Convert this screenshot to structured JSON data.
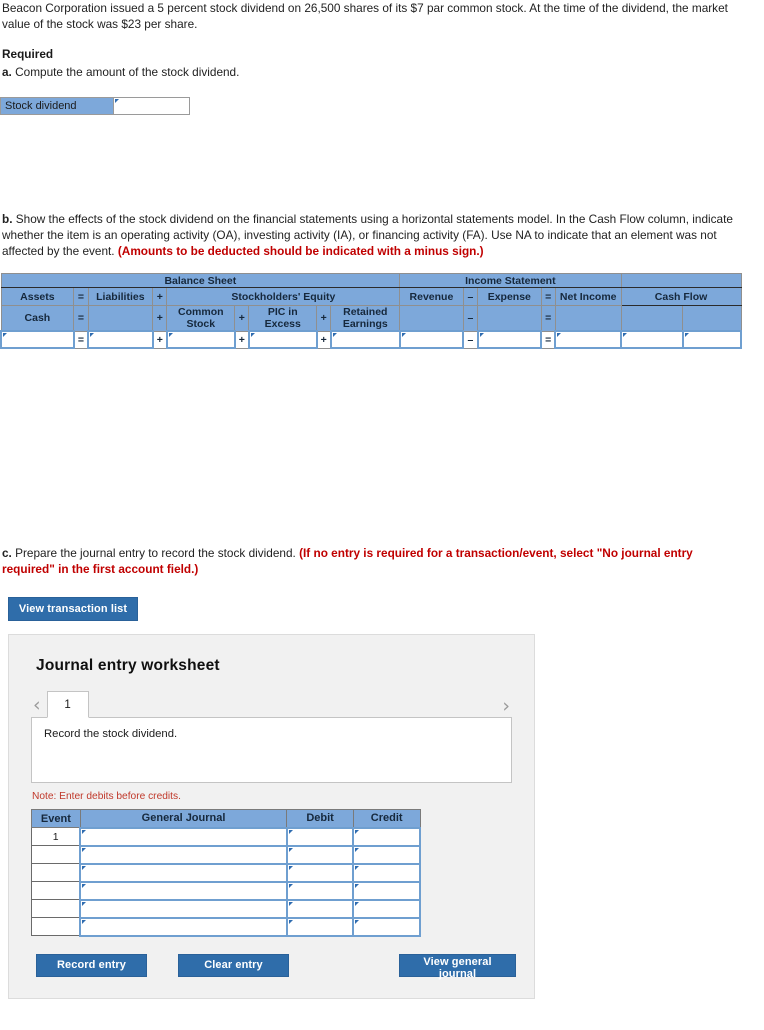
{
  "problem": {
    "statement": "Beacon Corporation issued a 5 percent stock dividend on 26,500 shares of its $7 par common stock. At the time of the dividend, the market value of the stock was $23 per share.",
    "required_heading": "Required",
    "part_a": {
      "marker": "a.",
      "text": "Compute the amount of the stock dividend.",
      "answer_label": "Stock dividend",
      "answer_value": "",
      "answer_placeholder": ""
    },
    "part_b": {
      "marker": "b.",
      "text": "Show the effects of the stock dividend on the financial statements using a horizontal statements model. In the Cash Flow column, indicate whether the item is an operating activity (OA), investing activity (IA), or financing activity (FA). Use NA to indicate that an element was not affected by the event.",
      "emphasis": "(Amounts to be deducted should be indicated with a minus sign.)"
    },
    "part_c": {
      "marker": "c.",
      "text": "Prepare the journal entry to record the stock dividend.",
      "emphasis": "(If no entry is required for a transaction/event, select \"No journal entry required\" in the first account field.)"
    }
  },
  "buttons": {
    "view_transaction_list": "View transaction list",
    "record_entry": "Record entry",
    "clear_entry": "Clear entry",
    "view_general_journal": "View general journal"
  },
  "horizontal_model": {
    "group_headers": [
      {
        "label": "Balance Sheet",
        "colspan": 9
      },
      {
        "label": "Income Statement",
        "colspan": 5
      },
      {
        "label": "",
        "colspan": 2
      }
    ],
    "row2": [
      {
        "label": "Assets",
        "type": "head"
      },
      {
        "label": "=",
        "type": "op"
      },
      {
        "label": "Liabilities",
        "type": "head"
      },
      {
        "label": "+",
        "type": "op"
      },
      {
        "label": "Stockholders' Equity",
        "type": "head",
        "colspan": 5
      },
      {
        "label": "Revenue",
        "type": "head"
      },
      {
        "label": "–",
        "type": "op"
      },
      {
        "label": "Expense",
        "type": "head"
      },
      {
        "label": "=",
        "type": "op"
      },
      {
        "label": "Net Income",
        "type": "head"
      },
      {
        "label": "Cash Flow",
        "type": "head",
        "colspan": 2
      }
    ],
    "row3": [
      {
        "label": "Cash",
        "type": "head"
      },
      {
        "label": "=",
        "type": "op"
      },
      {
        "label": "",
        "type": "blank"
      },
      {
        "label": "+",
        "type": "op"
      },
      {
        "label": "Common Stock",
        "type": "head"
      },
      {
        "label": "+",
        "type": "op"
      },
      {
        "label": "PIC in Excess",
        "type": "head"
      },
      {
        "label": "+",
        "type": "op"
      },
      {
        "label": "Retained Earnings",
        "type": "head"
      },
      {
        "label": "",
        "type": "blank"
      },
      {
        "label": "–",
        "type": "op"
      },
      {
        "label": "",
        "type": "blank"
      },
      {
        "label": "=",
        "type": "op"
      },
      {
        "label": "",
        "type": "blank"
      },
      {
        "label": "",
        "type": "blank"
      },
      {
        "label": "",
        "type": "blank"
      }
    ],
    "input_row_operators": [
      "=",
      "+",
      "+",
      "+",
      "–",
      "="
    ],
    "input_row_values": {
      "cash": "",
      "liabilities": "",
      "common_stock": "",
      "pic_in_excess": "",
      "retained_earnings": "",
      "revenue": "",
      "expense": "",
      "net_income": "",
      "cash_flow_1": "",
      "cash_flow_2": ""
    }
  },
  "worksheet": {
    "title": "Journal entry worksheet",
    "prev_icon": "chevron-left-icon",
    "next_icon": "chevron-right-icon",
    "tabs": [
      {
        "label": "1",
        "active": true
      }
    ],
    "instruction": "Record the stock dividend.",
    "note": "Note: Enter debits before credits.",
    "table": {
      "columns": [
        "Event",
        "General Journal",
        "Debit",
        "Credit"
      ],
      "rows": [
        {
          "event": "1",
          "account": "",
          "debit": "",
          "credit": ""
        },
        {
          "event": "",
          "account": "",
          "debit": "",
          "credit": ""
        },
        {
          "event": "",
          "account": "",
          "debit": "",
          "credit": ""
        },
        {
          "event": "",
          "account": "",
          "debit": "",
          "credit": ""
        },
        {
          "event": "",
          "account": "",
          "debit": "",
          "credit": ""
        },
        {
          "event": "",
          "account": "",
          "debit": "",
          "credit": ""
        }
      ]
    }
  },
  "colors": {
    "table_header_blue": "#7DA8DA",
    "button_blue": "#2F6DAA",
    "emphasis_red": "#c00000",
    "note_red": "#c0392b",
    "panel_gray": "#f1f1f1",
    "input_border_blue": "#6f9fd0"
  }
}
